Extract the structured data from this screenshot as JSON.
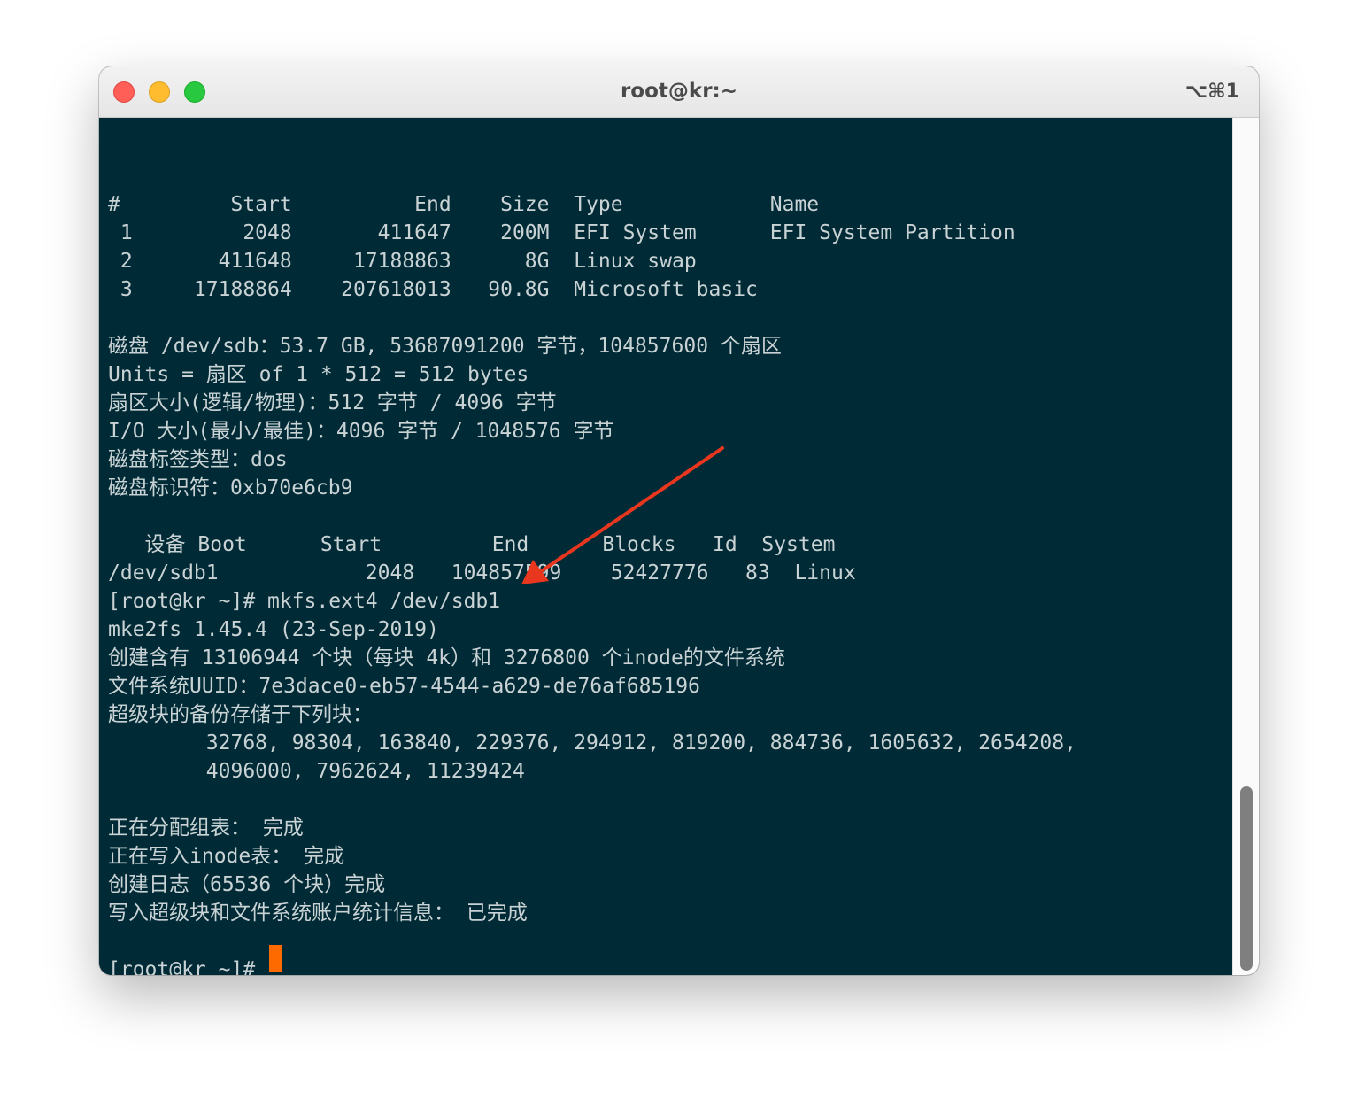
{
  "window": {
    "title": "root@kr:~",
    "shortcut": "⌥⌘1"
  },
  "colors": {
    "terminal_bg": "#002b36",
    "terminal_fg": "#c9d2d4",
    "cursor": "#ff6a00",
    "annotation_arrow": "#e8361f"
  },
  "terminal": {
    "lines": [
      "#         Start          End    Size  Type            Name",
      " 1         2048       411647    200M  EFI System      EFI System Partition",
      " 2       411648     17188863      8G  Linux swap",
      " 3     17188864    207618013   90.8G  Microsoft basic",
      "",
      "磁盘 /dev/sdb：53.7 GB, 53687091200 字节，104857600 个扇区",
      "Units = 扇区 of 1 * 512 = 512 bytes",
      "扇区大小(逻辑/物理)：512 字节 / 4096 字节",
      "I/O 大小(最小/最佳)：4096 字节 / 1048576 字节",
      "磁盘标签类型：dos",
      "磁盘标识符：0xb70e6cb9",
      "",
      "   设备 Boot      Start         End      Blocks   Id  System",
      "/dev/sdb1            2048   104857599    52427776   83  Linux",
      "[root@kr ~]# mkfs.ext4 /dev/sdb1",
      "mke2fs 1.45.4 (23-Sep-2019)",
      "创建含有 13106944 个块（每块 4k）和 3276800 个inode的文件系统",
      "文件系统UUID：7e3dace0-eb57-4544-a629-de76af685196",
      "超级块的备份存储于下列块：",
      "        32768, 98304, 163840, 229376, 294912, 819200, 884736, 1605632, 2654208,",
      "        4096000, 7962624, 11239424",
      "",
      "正在分配组表： 完成",
      "正在写入inode表： 完成",
      "创建日志（65536 个块）完成",
      "写入超级块和文件系统账户统计信息： 已完成",
      "",
      "[root@kr ~]# "
    ]
  }
}
